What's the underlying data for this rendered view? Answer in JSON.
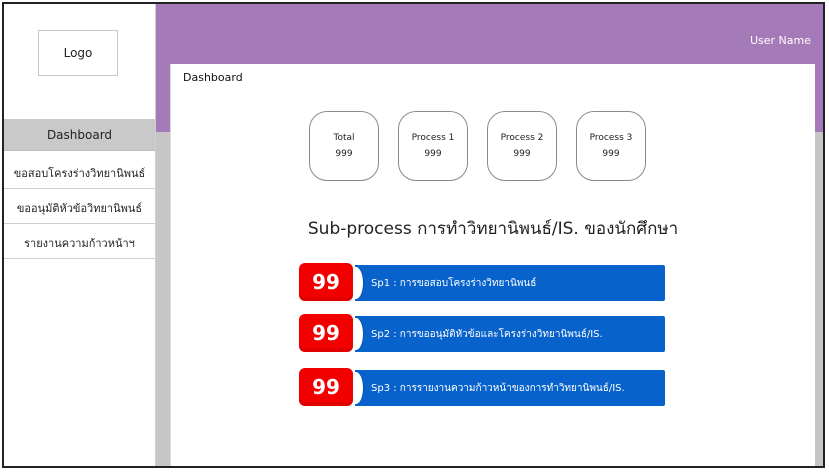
{
  "sidebar": {
    "logo": "Logo",
    "items": [
      {
        "label": "Dashboard",
        "active": true
      },
      {
        "label": "ขอสอบโครงร่างวิทยานิพนธ์",
        "active": false
      },
      {
        "label": "ขออนุมัติหัวข้อวิทยานิพนธ์",
        "active": false
      },
      {
        "label": "รายงานความก้าวหน้าฯ",
        "active": false
      }
    ]
  },
  "header": {
    "user_name": "User Name",
    "color": "#a57ab8"
  },
  "main": {
    "title": "Dashboard",
    "cards": [
      {
        "label": "Total",
        "value": "999"
      },
      {
        "label": "Process 1",
        "value": "999"
      },
      {
        "label": "Process 2",
        "value": "999"
      },
      {
        "label": "Process 3",
        "value": "999"
      }
    ],
    "section_title": "Sub-process การทำวิทยานิพนธ์/IS. ของนักศึกษา",
    "subprocesses": [
      {
        "count": "99",
        "label": "Sp1 : การขอสอบโครงร่างวิทยานิพนธ์"
      },
      {
        "count": "99",
        "label": "Sp2 : การขออนุมัติหัวข้อและโครงร่างวิทยานิพนธ์/IS."
      },
      {
        "count": "99",
        "label": "Sp3 : การรายงานความก้าวหน้าของการทำวิทยานิพนธ์/IS."
      }
    ]
  },
  "colors": {
    "badge": "#f20000",
    "bar": "#0862cc",
    "gutter": "#c6c6c6"
  }
}
